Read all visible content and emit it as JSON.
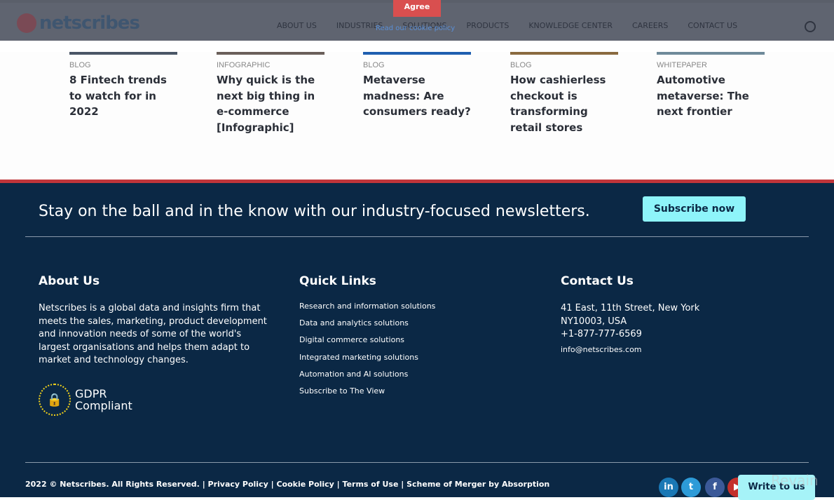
{
  "header": {
    "logo": "netscribes",
    "nav": [
      "ABOUT US",
      "INDUSTRIES",
      "SOLUTIONS",
      "PRODUCTS",
      "KNOWLEDGE CENTER",
      "CAREERS",
      "CONTACT US"
    ]
  },
  "cookie": {
    "agree": "Agree",
    "link": "Read our cookie policy"
  },
  "cards": [
    {
      "cat": "BLOG",
      "title": "8 Fintech trends to watch for in 2022"
    },
    {
      "cat": "INFOGRAPHIC",
      "title": "Why quick is the next big thing in e-commerce [Infographic]"
    },
    {
      "cat": "BLOG",
      "title": "Metaverse madness: Are consumers ready?"
    },
    {
      "cat": "BLOG",
      "title": "How cashierless checkout is transforming retail stores"
    },
    {
      "cat": "WHITEPAPER",
      "title": "Automotive metaverse: The next frontier"
    }
  ],
  "footer": {
    "newsletter": "Stay on the ball and in the know with our industry-focused newsletters.",
    "subscribe": "Subscribe now",
    "about": {
      "title": "About Us",
      "text": "Netscribes is a global data and insights firm that meets the sales, marketing, product development and innovation needs of some of the world's largest organisations and helps them adapt to market and technology changes."
    },
    "gdpr": {
      "line1": "GDPR",
      "line2": "Compliant"
    },
    "quick": {
      "title": "Quick Links",
      "links": [
        "Research and information solutions",
        "Data and analytics solutions",
        "Digital commerce solutions",
        "Integrated marketing solutions",
        "Automation and AI solutions",
        "Subscribe to The View"
      ]
    },
    "contact": {
      "title": "Contact Us",
      "address1": "41 East, 11th Street, New York",
      "address2": "NY10003, USA",
      "phone": "+1-877-777-6569",
      "email": "info@netscribes.com"
    },
    "copyright": "2022 © Netscribes. All Rights Reserved. | Privacy Policy | Cookie Policy | Terms of Use | Scheme of Merger by Absorption",
    "social": [
      {
        "icon": "linkedin-icon",
        "label": "in",
        "color": "#1a78b5"
      },
      {
        "icon": "twitter-icon",
        "label": "t",
        "color": "#2d9bd8"
      },
      {
        "icon": "facebook-icon",
        "label": "f",
        "color": "#3b5998"
      },
      {
        "icon": "youtube-icon",
        "label": "▶",
        "color": "#c4302b"
      }
    ],
    "write": "Write to us",
    "revain": "Revain"
  }
}
